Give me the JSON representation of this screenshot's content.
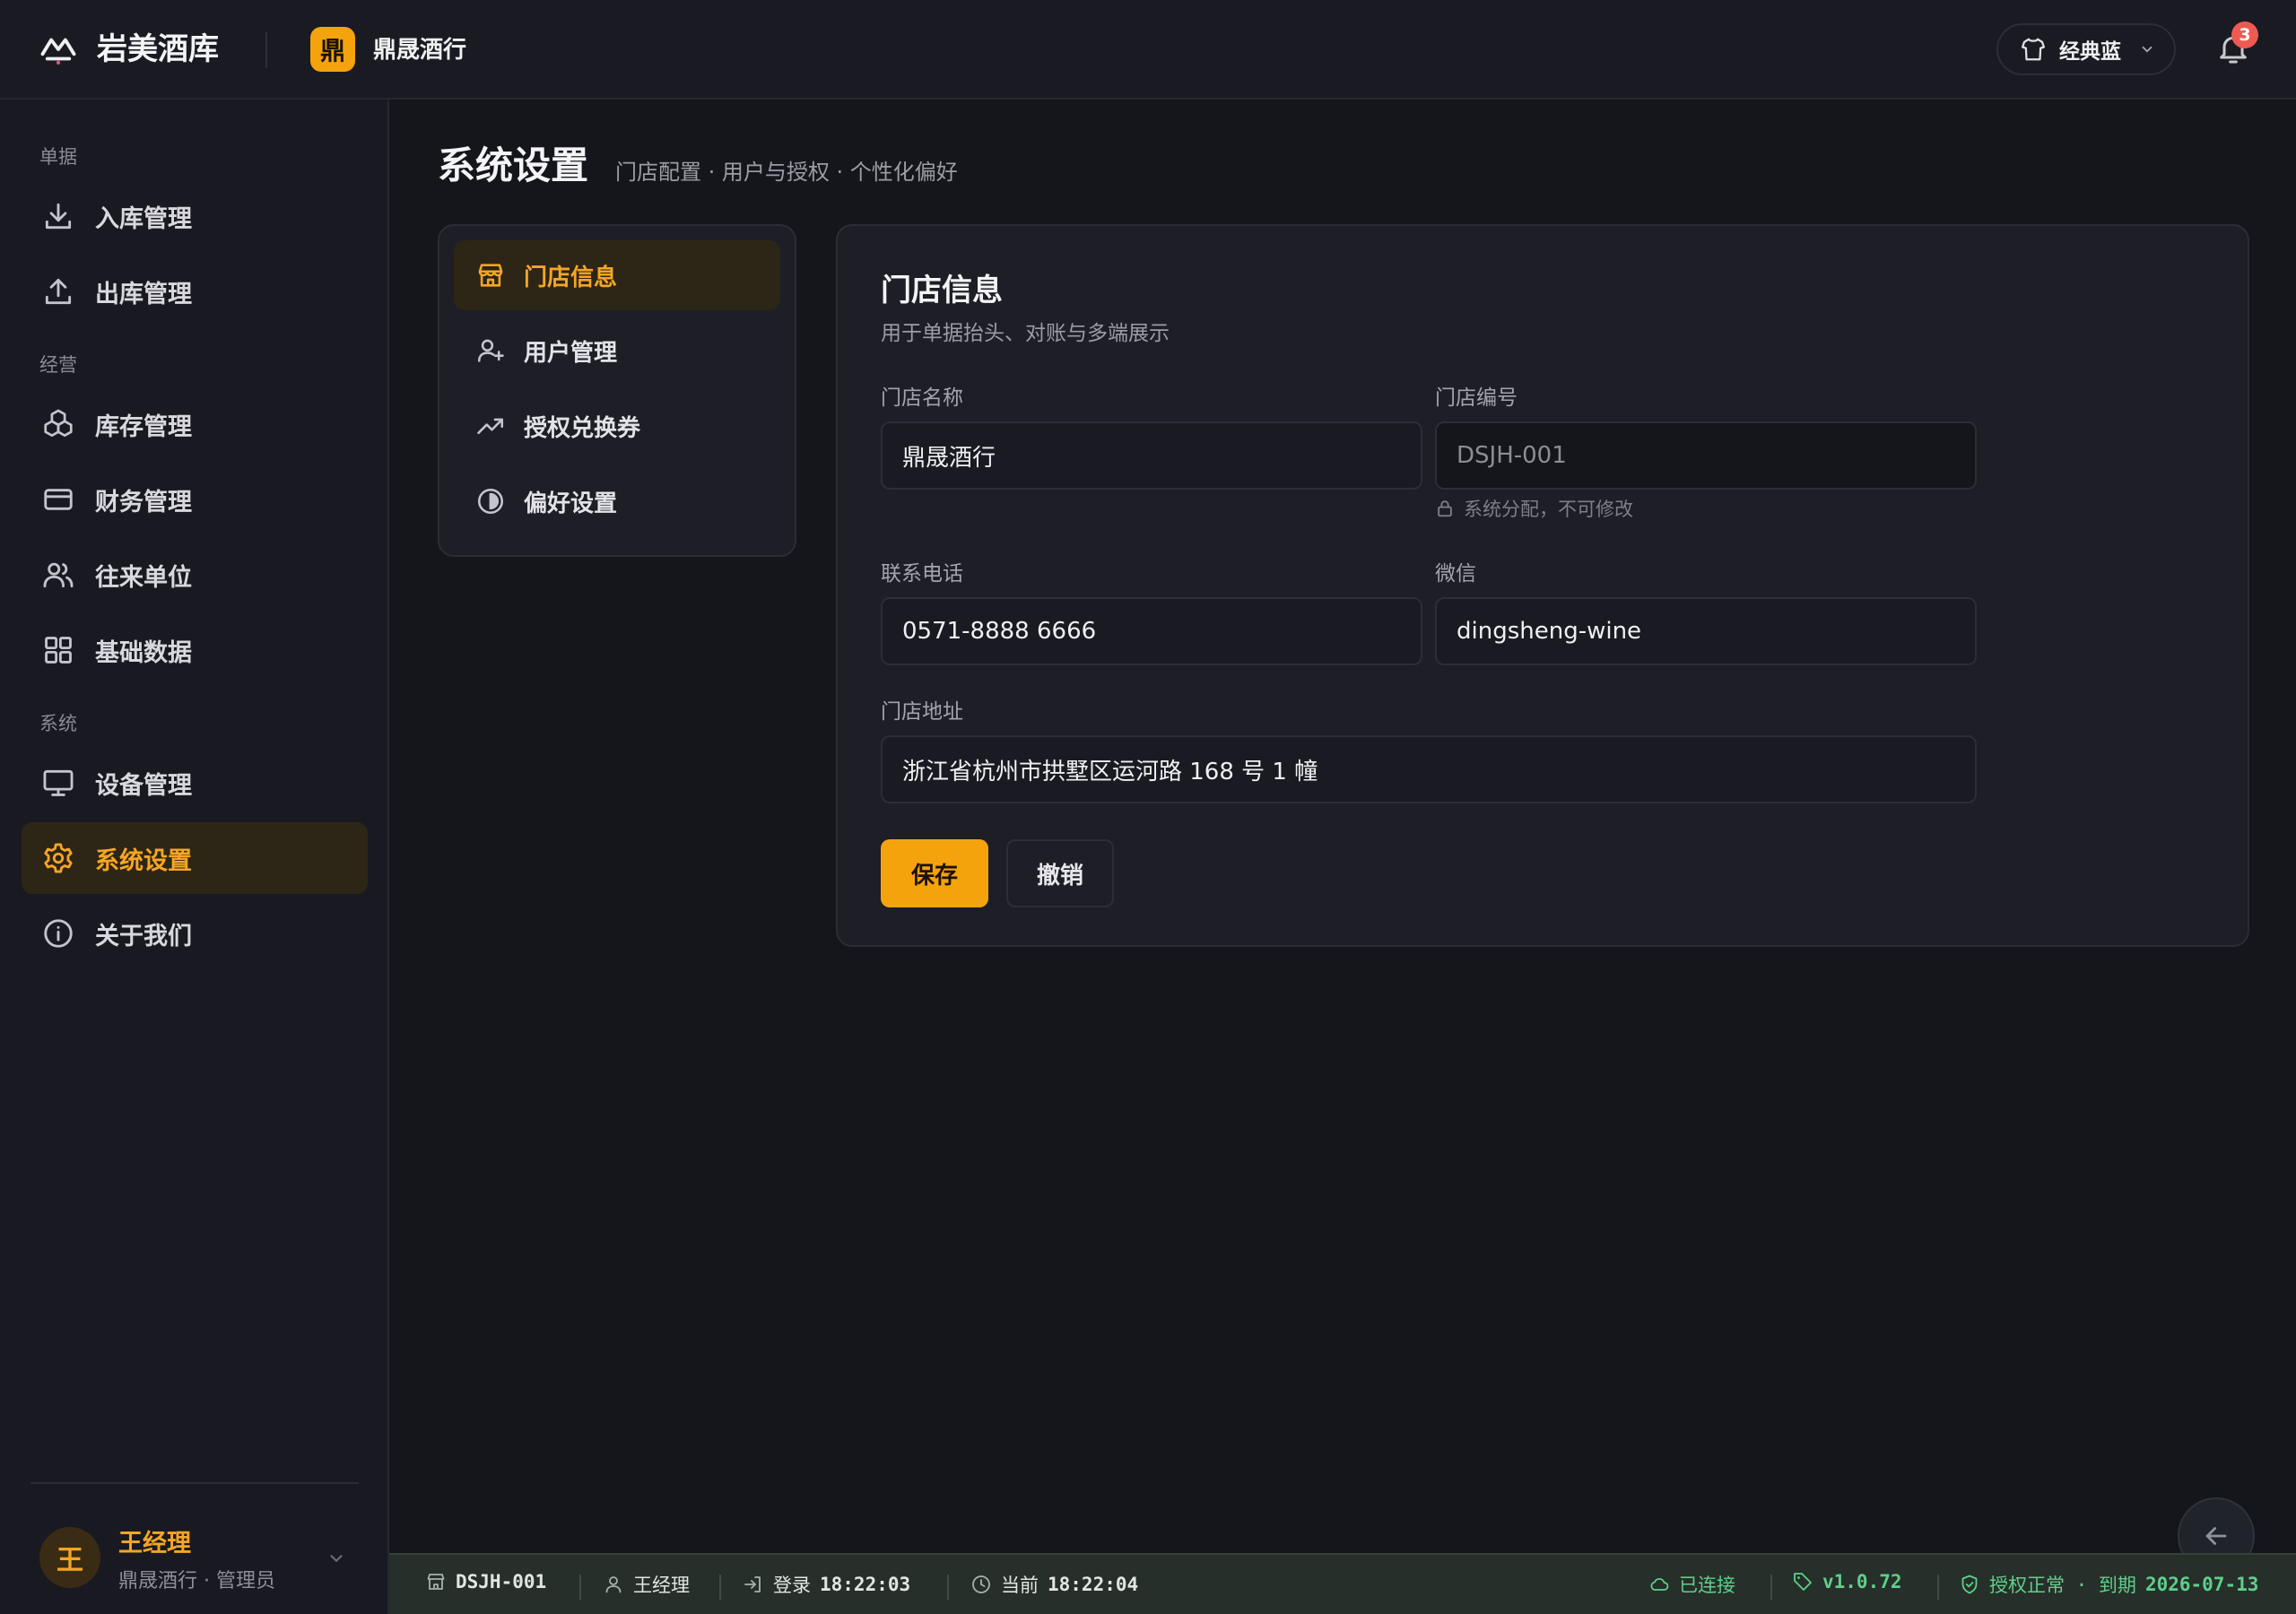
{
  "app": {
    "brand_name": "岩美酒库",
    "brand_icon": "mountain-logo-icon",
    "store_badge": "鼎",
    "store_name": "鼎晟酒行"
  },
  "topbar": {
    "theme_label": "经典蓝",
    "theme_icon": "shirt-icon",
    "notification_count": "3",
    "notification_icon": "bell-icon"
  },
  "sidebar": {
    "sections": [
      {
        "title": "单据",
        "items": [
          {
            "label": "入库管理",
            "icon": "download-icon"
          },
          {
            "label": "出库管理",
            "icon": "upload-icon"
          }
        ]
      },
      {
        "title": "经营",
        "items": [
          {
            "label": "库存管理",
            "icon": "boxes-icon"
          },
          {
            "label": "财务管理",
            "icon": "card-icon"
          },
          {
            "label": "往来单位",
            "icon": "users-icon"
          },
          {
            "label": "基础数据",
            "icon": "grid-icon"
          }
        ]
      },
      {
        "title": "系统",
        "items": [
          {
            "label": "设备管理",
            "icon": "monitor-icon"
          },
          {
            "label": "系统设置",
            "icon": "gear-icon",
            "active": true
          },
          {
            "label": "关于我们",
            "icon": "info-icon"
          }
        ]
      }
    ],
    "user": {
      "avatar": "王",
      "name": "王经理",
      "subtitle": "鼎晟酒行 · 管理员"
    }
  },
  "page": {
    "title": "系统设置",
    "subtitle": "门店配置 · 用户与授权 · 个性化偏好"
  },
  "subnav": {
    "items": [
      {
        "label": "门店信息",
        "icon": "store-icon",
        "active": true
      },
      {
        "label": "用户管理",
        "icon": "user-plus-icon"
      },
      {
        "label": "授权兑换券",
        "icon": "trend-icon"
      },
      {
        "label": "偏好设置",
        "icon": "contrast-icon"
      }
    ]
  },
  "form": {
    "title": "门店信息",
    "description": "用于单据抬头、对账与多端展示",
    "store_name_label": "门店名称",
    "store_name_value": "鼎晟酒行",
    "store_code_label": "门店编号",
    "store_code_value": "DSJH-001",
    "store_code_hint": "系统分配，不可修改",
    "phone_label": "联系电话",
    "phone_value": "0571-8888 6666",
    "wechat_label": "微信",
    "wechat_value": "dingsheng-wine",
    "address_label": "门店地址",
    "address_value": "浙江省杭州市拱墅区运河路 168 号 1 幢",
    "save_label": "保存",
    "cancel_label": "撤销"
  },
  "statusbar": {
    "store_code": "DSJH-001",
    "user": "王经理",
    "login_label": "登录",
    "login_time": "18:22:03",
    "current_label": "当前",
    "current_time": "18:22:04",
    "connection": "已连接",
    "version": "v1.0.72",
    "license_label": "授权正常 · 到期",
    "license_expiry": "2026-07-13"
  },
  "colors": {
    "accent": "#f5a30c",
    "background": "#15161c",
    "status_green": "#5fcf8b",
    "badge_red": "#ee5a52"
  }
}
